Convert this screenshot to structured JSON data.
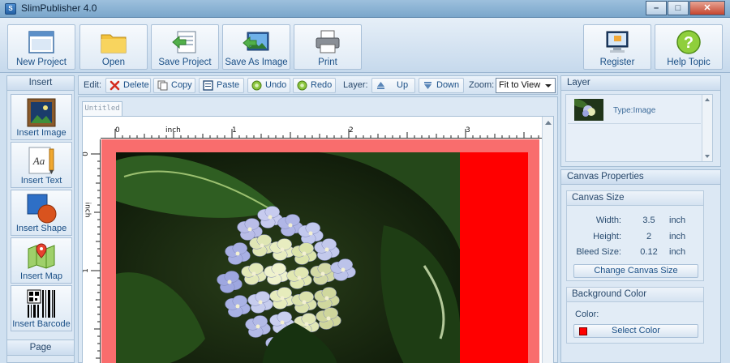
{
  "window": {
    "title": "SlimPublisher 4.0",
    "app_icon_text": "S",
    "minimize": "–",
    "maximize": "□",
    "close": "✕"
  },
  "toolbar": {
    "new_project": "New Project",
    "open": "Open",
    "save_project": "Save Project",
    "save_as_image": "Save As Image",
    "print": "Print",
    "register": "Register",
    "help_topic": "Help Topic"
  },
  "insert_panel": {
    "title": "Insert",
    "items": [
      "Insert Image",
      "Insert Text",
      "Insert Shape",
      "Insert Map",
      "Insert Barcode"
    ],
    "page_title": "Page"
  },
  "edit_bar": {
    "edit_label": "Edit:",
    "delete": "Delete",
    "copy": "Copy",
    "paste": "Paste",
    "undo": "Undo",
    "redo": "Redo",
    "layer_label": "Layer:",
    "up": "Up",
    "down": "Down",
    "zoom_label": "Zoom:",
    "zoom_value": "Fit to View"
  },
  "document": {
    "tab": "Untitled",
    "ruler_unit": "inch",
    "h_ticks": [
      "0",
      "1",
      "2",
      "3"
    ],
    "v_ticks": [
      "0",
      "1"
    ]
  },
  "layer_panel": {
    "title": "Layer",
    "item_type": "Type:Image"
  },
  "canvas_properties": {
    "title": "Canvas Properties",
    "size_group": "Canvas Size",
    "width_label": "Width:",
    "width_value": "3.5",
    "width_unit": "inch",
    "height_label": "Height:",
    "height_value": "2",
    "height_unit": "inch",
    "bleed_label": "Bleed Size:",
    "bleed_value": "0.12",
    "bleed_unit": "inch",
    "change_button": "Change Canvas Size",
    "bg_group": "Background Color",
    "color_label": "Color:",
    "select_color": "Select Color",
    "bg_color": "#ff0000"
  }
}
